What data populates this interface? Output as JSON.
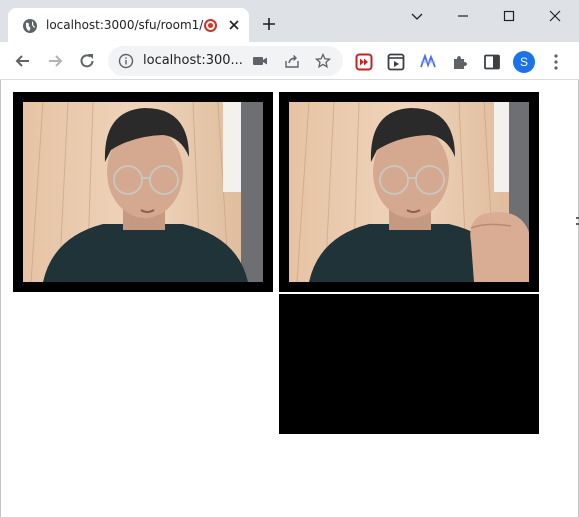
{
  "browser": {
    "tab": {
      "title": "localhost:3000/sfu/room1/",
      "favicon": "globe-icon",
      "recording_indicator": "recording-icon",
      "recording_color": "#d93025"
    },
    "address_bar": {
      "url": "localhost:300..."
    },
    "profile": {
      "avatar_letter": "S",
      "avatar_color": "#1a73e8"
    },
    "icons": {
      "back": "arrow-left-icon",
      "forward": "arrow-right-icon",
      "reload": "reload-icon",
      "camera": "camera-icon",
      "share": "share-icon",
      "bookmark": "star-icon",
      "extensions": [
        "red-forward-extension-icon",
        "screen-extension-icon",
        "wave-extension-icon",
        "puzzle-icon",
        "side-panel-icon"
      ],
      "menu": "more-vert-icon"
    }
  },
  "page": {
    "video_tiles": [
      {
        "name": "local-video",
        "content": "camera feed: person with glasses"
      },
      {
        "name": "remote-video-1",
        "content": "camera feed: person with glasses, hand on chin"
      },
      {
        "name": "remote-video-2",
        "content": "blank black video"
      }
    ]
  }
}
